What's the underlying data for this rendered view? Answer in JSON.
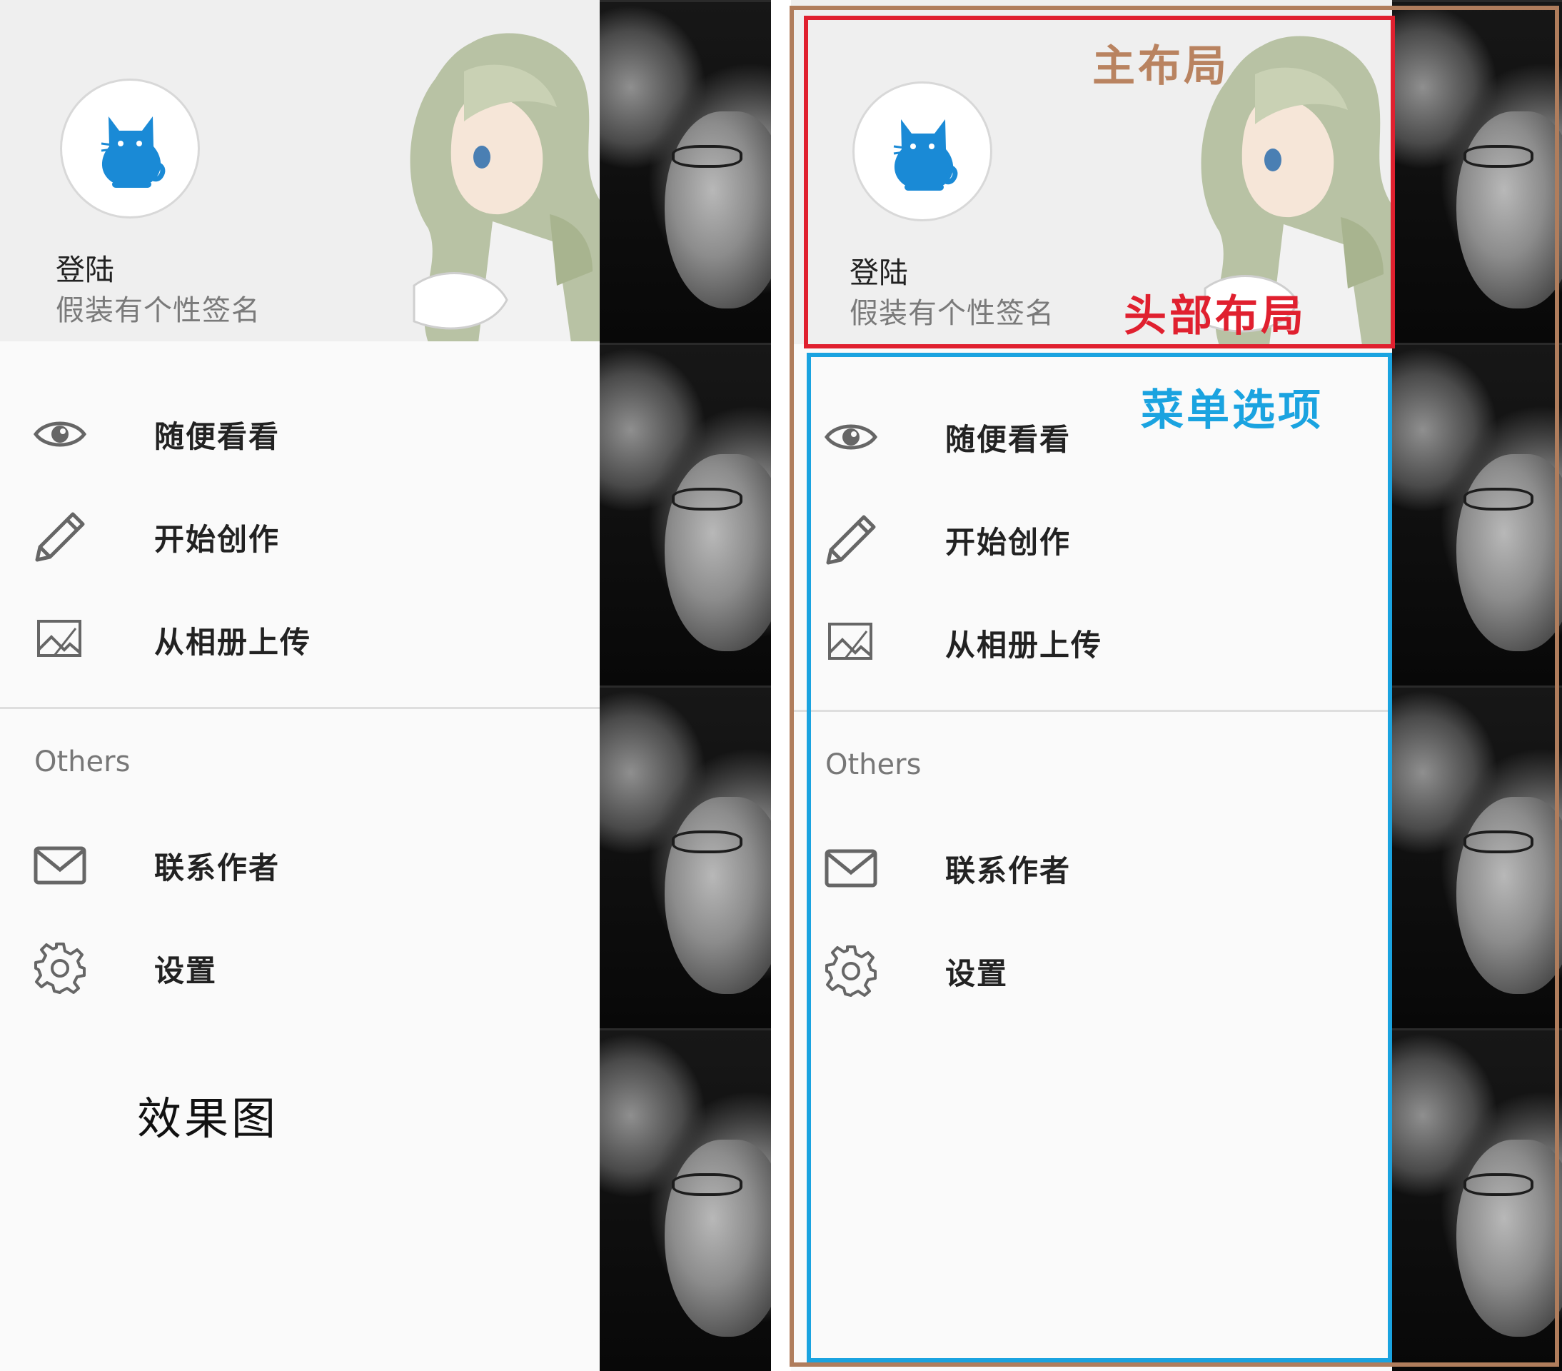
{
  "header": {
    "username": "登陆",
    "signature": "假装有个性签名"
  },
  "menu": {
    "items": [
      {
        "label": "随便看看",
        "icon": "eye-icon"
      },
      {
        "label": "开始创作",
        "icon": "pencil-icon"
      },
      {
        "label": "从相册上传",
        "icon": "image-icon"
      }
    ],
    "others_title": "Others",
    "others": [
      {
        "label": "联系作者",
        "icon": "mail-icon"
      },
      {
        "label": "设置",
        "icon": "gear-icon"
      }
    ]
  },
  "caption": "效果图",
  "annotations": {
    "main_layout": "主布局",
    "header_layout": "头部布局",
    "menu_options": "菜单选项"
  },
  "colors": {
    "cat_blue": "#1a8ad6",
    "main_frame": "#b07d5c",
    "header_frame": "#e0202f",
    "menu_frame": "#1aa3e0",
    "main_text": "#b98360",
    "header_text": "#e0202f",
    "menu_text": "#1aa3e0"
  }
}
